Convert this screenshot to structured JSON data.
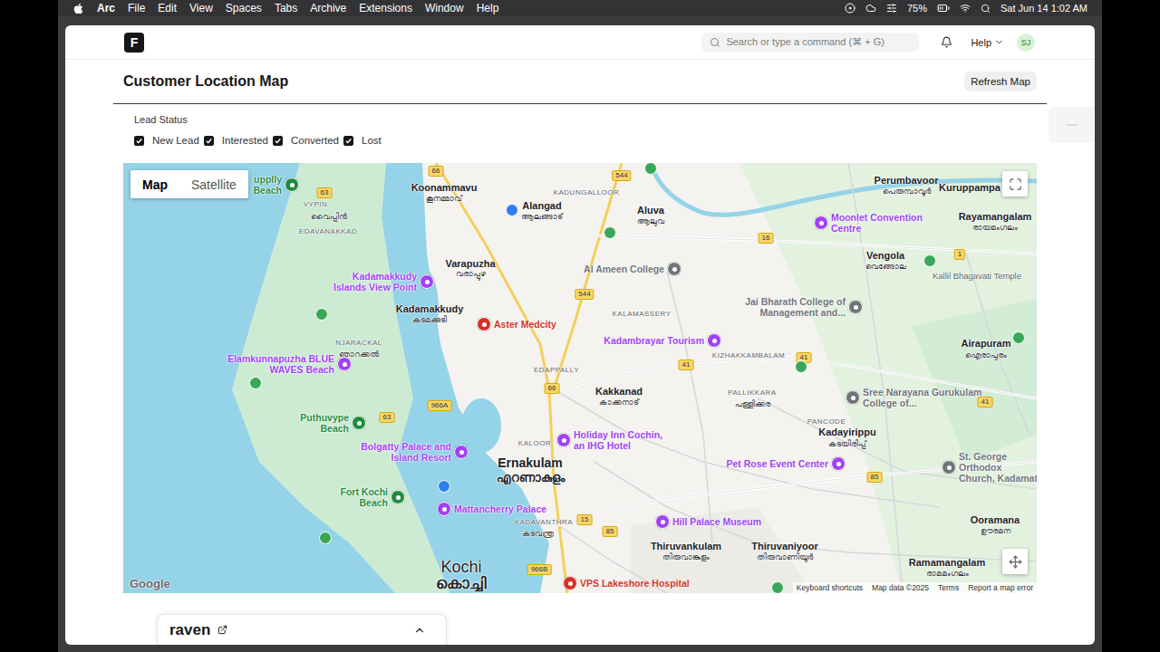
{
  "menubar": {
    "app": "Arc",
    "menus": [
      "File",
      "Edit",
      "View",
      "Spaces",
      "Tabs",
      "Archive",
      "Extensions",
      "Window",
      "Help"
    ],
    "battery": "75%",
    "clock": "Sat Jun 14 1:02 AM"
  },
  "navbar": {
    "logo": "F",
    "search_placeholder": "Search or type a command (⌘ + G)",
    "help": "Help",
    "avatar": "SJ"
  },
  "page": {
    "title": "Customer Location Map",
    "refresh_button": "Refresh Map"
  },
  "filter": {
    "label": "Lead Status",
    "options": [
      {
        "label": "New Lead",
        "checked": true
      },
      {
        "label": "Interested",
        "checked": true
      },
      {
        "label": "Converted",
        "checked": true
      },
      {
        "label": "Lost",
        "checked": true
      }
    ]
  },
  "map": {
    "type_tabs": [
      {
        "label": "Map",
        "selected": true
      },
      {
        "label": "Satellite",
        "selected": false
      }
    ],
    "labels": [
      {
        "text": "upplly Beach",
        "kind": "poi",
        "color": "#1e8e3e"
      },
      {
        "text": "VYPIN",
        "kind": "area"
      },
      {
        "text": "വൈപ്പിൻ",
        "kind": "ml"
      },
      {
        "text": "EDAVANAKKAD",
        "kind": "area"
      },
      {
        "text": "Koonammavu",
        "kind": "place"
      },
      {
        "text": "കൂനമ്മാവ്",
        "kind": "ml"
      },
      {
        "text": "Alangad",
        "kind": "place"
      },
      {
        "text": "ആലങ്ങാട്",
        "kind": "ml"
      },
      {
        "text": "KADUNGALLOOR",
        "kind": "area"
      },
      {
        "text": "Aluva",
        "kind": "place"
      },
      {
        "text": "ആലുവ",
        "kind": "ml"
      },
      {
        "text": "Perumbavoor",
        "kind": "place"
      },
      {
        "text": "പെരുമ്പാവൂർ",
        "kind": "ml"
      },
      {
        "text": "Kuruppampa",
        "kind": "place"
      },
      {
        "text": "Rayamangalam",
        "kind": "place"
      },
      {
        "text": "രായമംഗലം",
        "kind": "ml"
      },
      {
        "text": "Moonlet Convention Centre",
        "kind": "poi",
        "color": "#a142f4"
      },
      {
        "text": "Vengola",
        "kind": "place"
      },
      {
        "text": "വെങ്ങോല",
        "kind": "ml"
      },
      {
        "text": "Kallil Bhagavati Temple",
        "kind": "note"
      },
      {
        "text": "Kadamakkudy Islands View Point",
        "kind": "poi",
        "color": "#a142f4"
      },
      {
        "text": "Varapuzha",
        "kind": "place"
      },
      {
        "text": "വരാപ്പുഴ",
        "kind": "ml"
      },
      {
        "text": "Kadamakkudy",
        "kind": "place"
      },
      {
        "text": "കടമക്കുടി",
        "kind": "ml"
      },
      {
        "text": "Al Ameen College",
        "kind": "poi",
        "color": "#70757a"
      },
      {
        "text": "Aster Medcity",
        "kind": "poi",
        "color": "#d93025"
      },
      {
        "text": "Jai Bharath College of Management and...",
        "kind": "poi",
        "color": "#70757a"
      },
      {
        "text": "NJARACKAL",
        "kind": "area"
      },
      {
        "text": "ഞാറക്കൽ",
        "kind": "ml"
      },
      {
        "text": "KALAMASSERY",
        "kind": "area"
      },
      {
        "text": "Kadambrayar Tourism",
        "kind": "poi",
        "color": "#a142f4"
      },
      {
        "text": "KIZHAKKAMBALAM",
        "kind": "area"
      },
      {
        "text": "Airapuram",
        "kind": "place"
      },
      {
        "text": "ഐരാപുരം",
        "kind": "ml"
      },
      {
        "text": "Elamkunnapuzha BLUE WAVES Beach",
        "kind": "poi",
        "color": "#a142f4"
      },
      {
        "text": "EDAPPALLY",
        "kind": "area"
      },
      {
        "text": "Kakkanad",
        "kind": "place"
      },
      {
        "text": "കാക്കനാട്",
        "kind": "ml"
      },
      {
        "text": "PALLIKKARA",
        "kind": "area"
      },
      {
        "text": "പള്ളിക്കര",
        "kind": "ml"
      },
      {
        "text": "Sree Narayana Gurukulam College of...",
        "kind": "poi",
        "color": "#70757a"
      },
      {
        "text": "Puthuvype Beach",
        "kind": "poi",
        "color": "#1e8e3e"
      },
      {
        "text": "Bolgatty Palace and Island Resort",
        "kind": "poi",
        "color": "#a142f4"
      },
      {
        "text": "Holiday Inn Cochin, an IHG Hotel",
        "kind": "poi",
        "color": "#a142f4"
      },
      {
        "text": "KALOOR",
        "kind": "area"
      },
      {
        "text": "Ernakulam",
        "kind": "big"
      },
      {
        "text": "എറണാകുളം",
        "kind": "bigml"
      },
      {
        "text": "PANCODE",
        "kind": "area"
      },
      {
        "text": "Kadayirippu",
        "kind": "place"
      },
      {
        "text": "കടയിരിപ്പ്",
        "kind": "ml"
      },
      {
        "text": "Pet Rose Event Center",
        "kind": "poi",
        "color": "#a142f4"
      },
      {
        "text": "St. George Orthodox Church, Kadamat",
        "kind": "poi",
        "color": "#70757a"
      },
      {
        "text": "Fort Kochi Beach",
        "kind": "poi",
        "color": "#1e8e3e"
      },
      {
        "text": "Mattancherry Palace",
        "kind": "poi",
        "color": "#a142f4"
      },
      {
        "text": "KADAVANTHRA",
        "kind": "area"
      },
      {
        "text": "കടവന്ത്ര",
        "kind": "ml"
      },
      {
        "text": "Hill Palace Museum",
        "kind": "poi",
        "color": "#a142f4"
      },
      {
        "text": "Thiruvankulam",
        "kind": "place"
      },
      {
        "text": "തിരുവാങ്കുളം",
        "kind": "ml"
      },
      {
        "text": "Thiruvaniyoor",
        "kind": "place"
      },
      {
        "text": "തിരുവാണിയൂർ",
        "kind": "ml"
      },
      {
        "text": "Ooramana",
        "kind": "place"
      },
      {
        "text": "ഊരമന",
        "kind": "ml"
      },
      {
        "text": "Ramamangalam",
        "kind": "place"
      },
      {
        "text": "രാമമംഗലം",
        "kind": "ml"
      },
      {
        "text": "Kochi",
        "kind": "city"
      },
      {
        "text": "കൊച്ചി",
        "kind": "cityml"
      },
      {
        "text": "VPS Lakeshore Hospital",
        "kind": "poi",
        "color": "#d93025"
      },
      {
        "text": "66",
        "kind": "road"
      },
      {
        "text": "544",
        "kind": "road"
      },
      {
        "text": "63",
        "kind": "road"
      },
      {
        "text": "544",
        "kind": "road"
      },
      {
        "text": "16",
        "kind": "road"
      },
      {
        "text": "1",
        "kind": "road"
      },
      {
        "text": "41",
        "kind": "road"
      },
      {
        "text": "41",
        "kind": "road"
      },
      {
        "text": "41",
        "kind": "road"
      },
      {
        "text": "66",
        "kind": "road"
      },
      {
        "text": "966A",
        "kind": "road"
      },
      {
        "text": "63",
        "kind": "road"
      },
      {
        "text": "85",
        "kind": "road"
      },
      {
        "text": "15",
        "kind": "road"
      },
      {
        "text": "85",
        "kind": "road"
      },
      {
        "text": "966B",
        "kind": "road"
      }
    ],
    "pins": [
      {
        "color": "#3aa757"
      },
      {
        "color": "#3aa757"
      },
      {
        "color": "#3aa757"
      },
      {
        "color": "#3aa757"
      },
      {
        "color": "#3aa757"
      },
      {
        "color": "#3aa757"
      },
      {
        "color": "#3aa757"
      },
      {
        "color": "#3aa757"
      },
      {
        "color": "#3aa757"
      },
      {
        "color": "#2f80ed"
      },
      {
        "color": "#2f80ed"
      }
    ],
    "attribution": {
      "logo": "Google",
      "links": [
        "Keyboard shortcuts",
        "Map data ©2025",
        "Terms",
        "Report a map error"
      ]
    }
  },
  "chat_bar": {
    "title": "raven"
  }
}
